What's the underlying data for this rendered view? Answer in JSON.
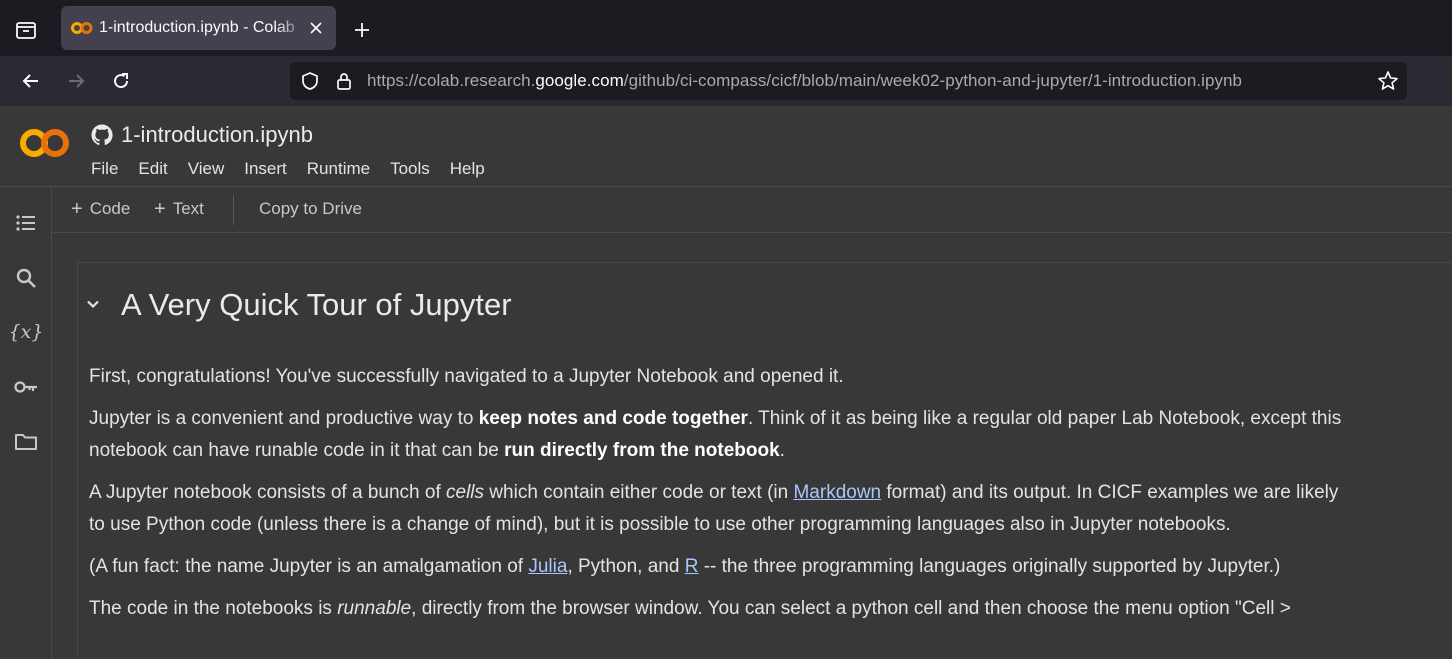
{
  "browser": {
    "tab": {
      "title": "1-introduction.ipynb - Colab"
    },
    "url": {
      "prefix": "https://colab.research.",
      "host": "google.com",
      "path": "/github/ci-compass/cicf/blob/main/week02-python-and-jupyter/1-introduction.ipynb"
    }
  },
  "header": {
    "notebook_title": "1-introduction.ipynb",
    "menu": [
      "File",
      "Edit",
      "View",
      "Insert",
      "Runtime",
      "Tools",
      "Help"
    ]
  },
  "toolbar": {
    "code_label": "Code",
    "text_label": "Text",
    "copy_label": "Copy to Drive"
  },
  "rail": {
    "variables_glyph": "{x}"
  },
  "cell": {
    "heading": "A Very Quick Tour of Jupyter",
    "p1": "First, congratulations! You've successfully navigated to a Jupyter Notebook and opened it.",
    "p2": {
      "a": "Jupyter is a convenient and productive way to ",
      "b_bold": "keep notes and code together",
      "c": ". Think of it as being like a regular old paper Lab Notebook, except this notebook can have runable code in it that can be ",
      "d_bold": "run directly from the notebook",
      "e": "."
    },
    "p3": {
      "a": "A Jupyter notebook consists of a bunch of ",
      "b_italic": "cells",
      "c": " which contain either code or text (in ",
      "d_link": "Markdown",
      "e": " format) and its output. In CICF examples we are likely to use Python code (unless there is a change of mind), but it is possible to use other programming languages also in Jupyter notebooks."
    },
    "p4": {
      "a": "(A fun fact: the name Jupyter is an amalgamation of ",
      "b_link": "Julia",
      "c": ", Python, and ",
      "d_link": "R",
      "e": " -- the three programming languages originally supported by Jupyter.)"
    },
    "p5": {
      "a": "The code in the notebooks is ",
      "b_italic": "runnable",
      "c": ", directly from the browser window. You can select a python cell and then choose the menu option \"Cell >"
    }
  }
}
